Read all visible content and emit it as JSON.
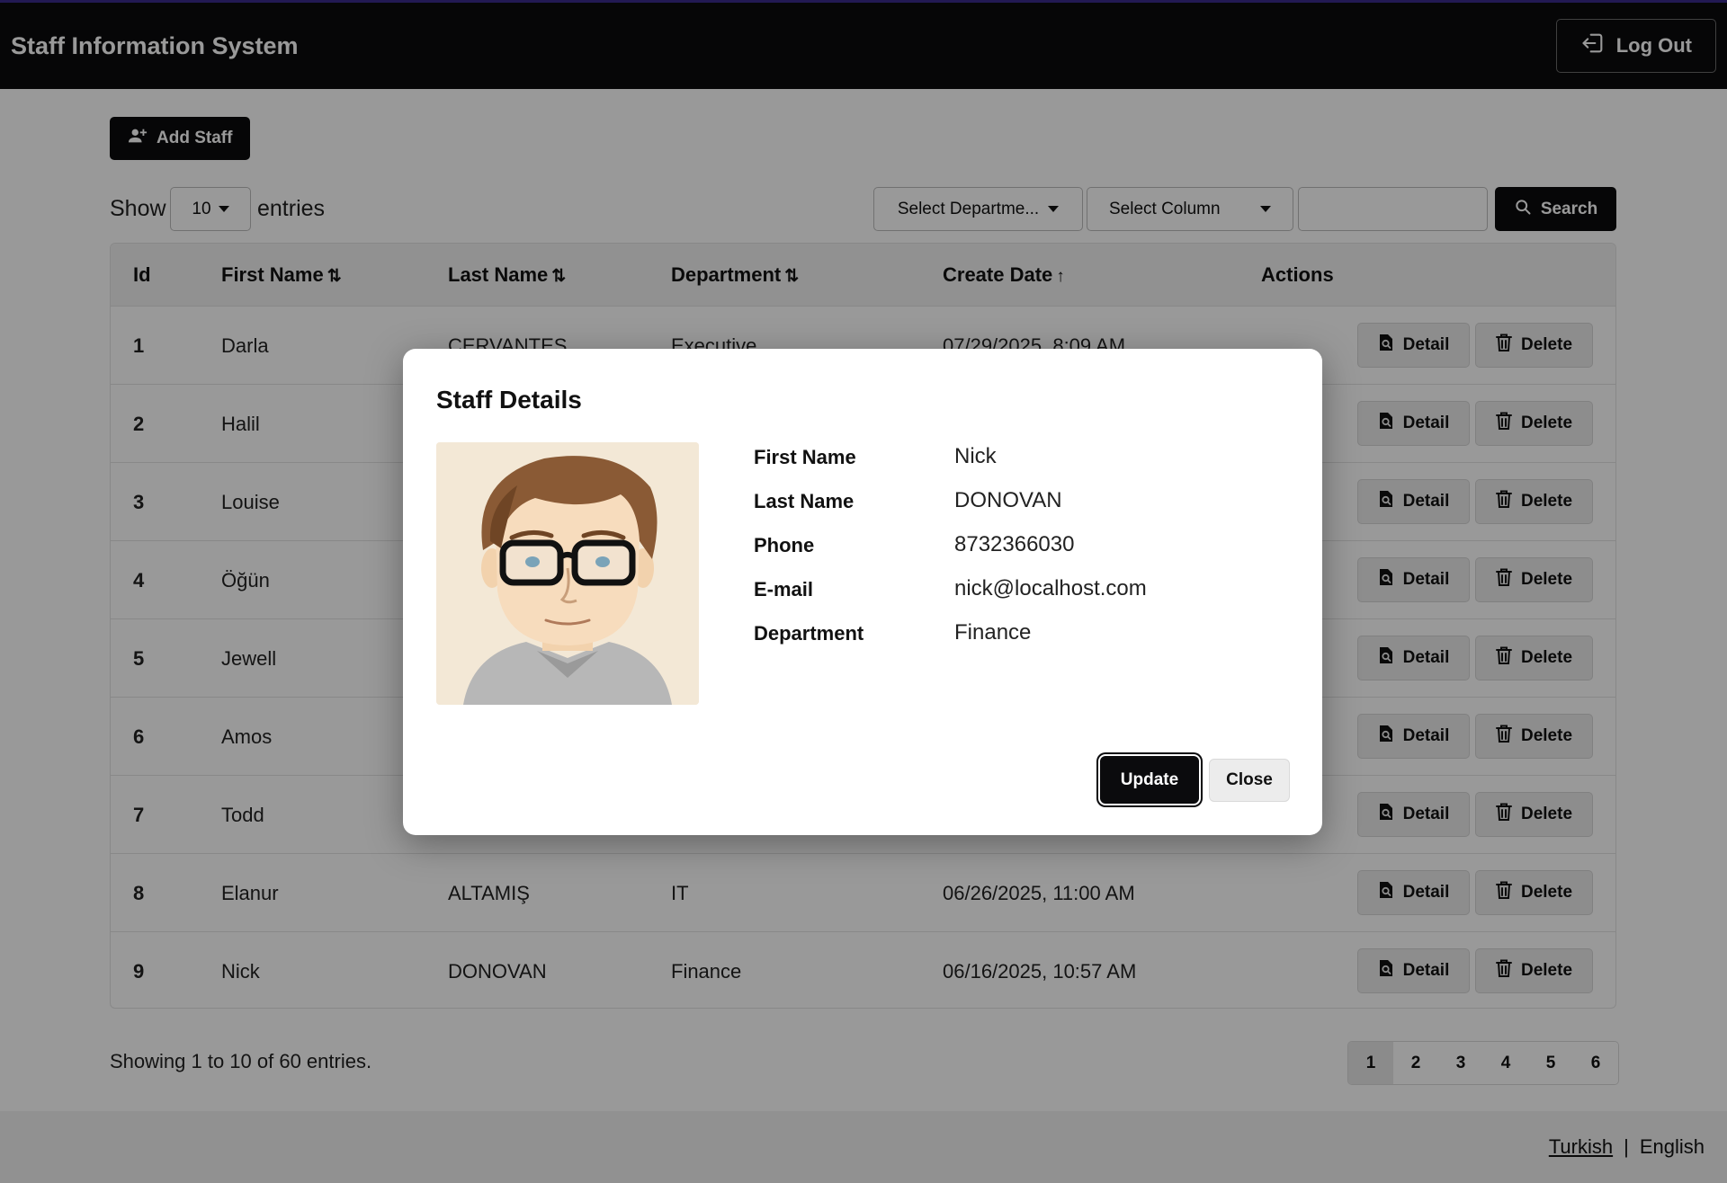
{
  "app": {
    "title": "Staff Information System",
    "logout_label": "Log Out"
  },
  "toolbar": {
    "add_staff_label": "Add Staff",
    "show_label": "Show",
    "entries_value": "10",
    "entries_label": "entries",
    "department_select": "Select Departme...",
    "column_select": "Select Column",
    "search_value": "",
    "search_label": "Search"
  },
  "table": {
    "headers": {
      "id": "Id",
      "first_name": "First Name",
      "last_name": "Last Name",
      "department": "Department",
      "create_date": "Create Date",
      "actions": "Actions"
    },
    "sort_icons": {
      "first_name": "⇅",
      "last_name": "⇅",
      "department": "⇅",
      "create_date": "↑"
    },
    "rows": [
      {
        "id": "1",
        "first_name": "Darla",
        "last_name": "CERVANTES",
        "department": "Executive",
        "create_date": "07/29/2025, 8:09 AM"
      },
      {
        "id": "2",
        "first_name": "Halil",
        "last_name": "",
        "department": "",
        "create_date": ""
      },
      {
        "id": "3",
        "first_name": "Louise",
        "last_name": "",
        "department": "",
        "create_date": ""
      },
      {
        "id": "4",
        "first_name": "Öğün",
        "last_name": "",
        "department": "",
        "create_date": ""
      },
      {
        "id": "5",
        "first_name": "Jewell",
        "last_name": "",
        "department": "",
        "create_date": ""
      },
      {
        "id": "6",
        "first_name": "Amos",
        "last_name": "",
        "department": "",
        "create_date": ""
      },
      {
        "id": "7",
        "first_name": "Todd",
        "last_name": "",
        "department": "",
        "create_date": ""
      },
      {
        "id": "8",
        "first_name": "Elanur",
        "last_name": "ALTAMIŞ",
        "department": "IT",
        "create_date": "06/26/2025, 11:00 AM"
      },
      {
        "id": "9",
        "first_name": "Nick",
        "last_name": "DONOVAN",
        "department": "Finance",
        "create_date": "06/16/2025, 10:57 AM"
      }
    ],
    "detail_label": "Detail",
    "delete_label": "Delete"
  },
  "pagination": {
    "summary": "Showing 1 to 10 of 60 entries.",
    "pages": [
      "1",
      "2",
      "3",
      "4",
      "5",
      "6"
    ],
    "active_page": "1"
  },
  "footer": {
    "lang_turkish": "Turkish",
    "separator": "|",
    "lang_english": "English"
  },
  "modal": {
    "title": "Staff Details",
    "fields": [
      {
        "label": "First Name",
        "value": "Nick"
      },
      {
        "label": "Last Name",
        "value": "DONOVAN"
      },
      {
        "label": "Phone",
        "value": "8732366030"
      },
      {
        "label": "E-mail",
        "value": "nick@localhost.com"
      },
      {
        "label": "Department",
        "value": "Finance"
      }
    ],
    "update_label": "Update",
    "close_label": "Close"
  }
}
